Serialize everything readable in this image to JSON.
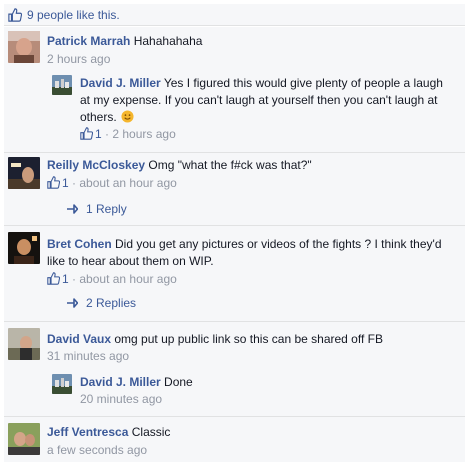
{
  "likes": {
    "text": "9 people like this."
  },
  "comments": [
    {
      "author": "Patrick Marrah",
      "text": "Hahahahaha",
      "time": "2 hours ago",
      "replies": [
        {
          "author": "David J. Miller",
          "line1": "Yes I figured this would give plenty of people a laugh",
          "line2": "at my expense. If you can't laugh at yourself then you can't laugh at",
          "line3": "others.",
          "like_count": "1",
          "time": "2 hours ago"
        }
      ]
    },
    {
      "author": "Reilly McCloskey",
      "text": "Omg \"what the f#ck was that?\"",
      "like_count": "1",
      "time": "about an hour ago",
      "reply_link": "1 Reply"
    },
    {
      "author": "Bret Cohen",
      "line1": "Did you get any pictures or videos of the fights ? I think they'd",
      "line2": "like to hear about them on WIP.",
      "like_count": "1",
      "time": "about an hour ago",
      "reply_link": "2 Replies"
    },
    {
      "author": "David Vaux",
      "text": "omg put up public link so this can be shared off FB",
      "time": "31 minutes ago",
      "replies": [
        {
          "author": "David J. Miller",
          "text": "Done",
          "time": "20 minutes ago"
        }
      ]
    },
    {
      "author": "Jeff Ventresca",
      "text": "Classic",
      "time": "a few seconds ago"
    }
  ],
  "separator": "·",
  "colors": {
    "link": "#3b5998",
    "meta": "#9197a3",
    "background": "#f6f7f9",
    "divider": "#e1e2e3",
    "emoji": "#f5b62d"
  },
  "icons": {
    "like": "thumbs-up-icon",
    "reply": "reply-arrow-icon",
    "emoji": "smiley-emoji-icon"
  }
}
